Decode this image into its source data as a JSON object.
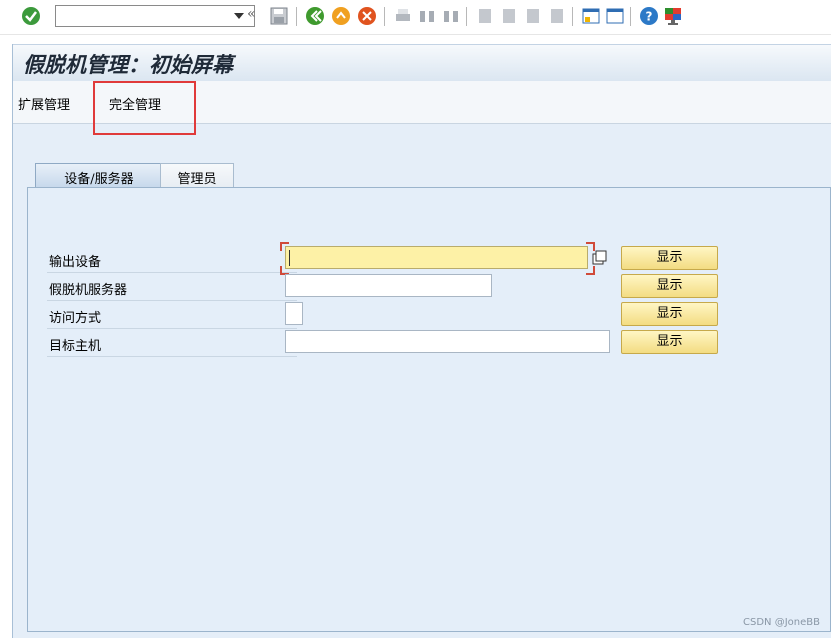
{
  "toolbar": {
    "command_field_value": "",
    "back_glyph": "«",
    "icons": [
      "enter-icon",
      "dropdown-icon",
      "back-icon",
      "save-icon",
      "back-green-icon",
      "exit-icon",
      "cancel-icon",
      "print-icon",
      "find-icon",
      "find-next-icon",
      "first-page-icon",
      "previous-page-icon",
      "next-page-icon",
      "last-page-icon",
      "create-session-icon",
      "shortcut-icon",
      "help-icon",
      "customize-layout-icon"
    ]
  },
  "page": {
    "title": "假脱机管理：初始屏幕"
  },
  "menu": {
    "items": [
      {
        "label": "扩展管理"
      },
      {
        "label": "完全管理"
      }
    ]
  },
  "tabs": [
    {
      "label": "设备/服务器",
      "active": true
    },
    {
      "label": "管理员",
      "active": false
    }
  ],
  "form": {
    "rows": [
      {
        "label": "输出设备",
        "value": "",
        "button": "显示"
      },
      {
        "label": "假脱机服务器",
        "value": "",
        "button": "显示"
      },
      {
        "label": "访问方式",
        "value": "",
        "button": "显示"
      },
      {
        "label": "目标主机",
        "value": "",
        "button": "显示"
      }
    ]
  },
  "watermark": "CSDN @JoneBB",
  "colors": {
    "highlight": "#e03a3a",
    "focused_field": "#fdf1a6",
    "button": "#f3dc82",
    "panel": "#e4eef9"
  }
}
